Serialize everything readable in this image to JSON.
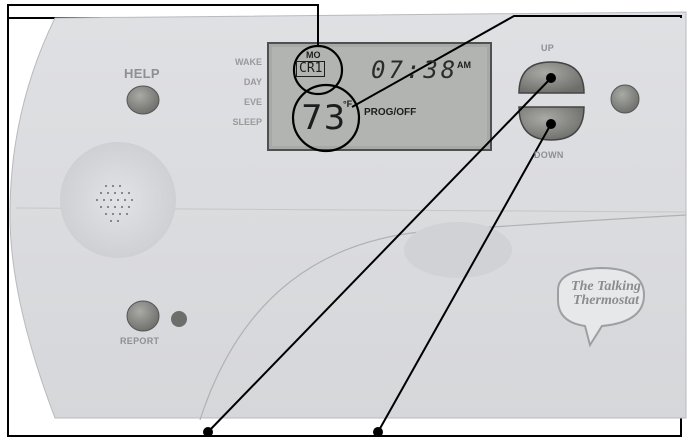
{
  "labels": {
    "help": "HELP",
    "report": "REPORT",
    "up": "UP",
    "down": "DOWN"
  },
  "modes": [
    "WAKE",
    "DAY",
    "EVE",
    "SLEEP"
  ],
  "lcd": {
    "day": "MO",
    "program": "CR1",
    "time": "07:38",
    "ampm": "AM",
    "temperature": "73",
    "unit": "°F",
    "status": "PROG/OFF"
  },
  "brand": {
    "line1": "The Talking",
    "line2": "Thermostat"
  }
}
